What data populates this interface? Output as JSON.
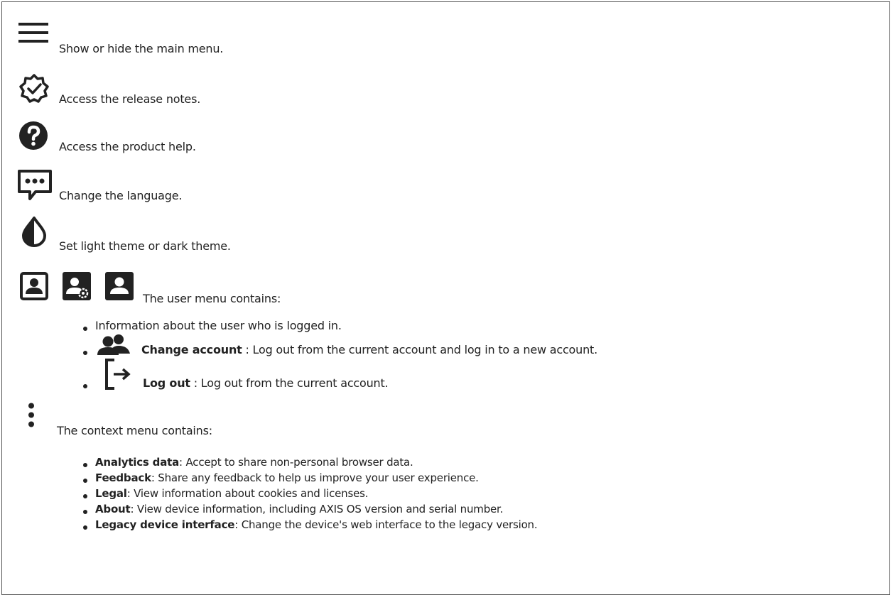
{
  "items": {
    "menu": "Show or hide the main menu.",
    "release": "Access the release notes.",
    "help": "Access the product help.",
    "language": "Change the language.",
    "theme": "Set light theme or dark theme.",
    "user": "The user menu contains:"
  },
  "user_menu": {
    "info": "Information about the user who is logged in.",
    "change_account_label": "Change account",
    "change_account_text": " : Log out from the current account and log in to a new account.",
    "logout_label": "Log out",
    "logout_text": " : Log out from the current account."
  },
  "context": {
    "intro": "The context menu contains:",
    "items": [
      {
        "label": "Analytics data",
        "text": ": Accept to share non-personal browser data."
      },
      {
        "label": "Feedback",
        "text": ": Share any feedback to help us improve your user experience."
      },
      {
        "label": "Legal",
        "text": ": View information about cookies and licenses."
      },
      {
        "label": "About",
        "text": ": View device information, including AXIS OS version and serial number."
      },
      {
        "label": "Legacy device interface",
        "text": ": Change the device's web interface to the legacy version."
      }
    ]
  },
  "icons": [
    "menu-icon",
    "release-notes-icon",
    "help-icon",
    "language-icon",
    "theme-icon",
    "user-icon",
    "user-settings-icon",
    "user-filled-icon",
    "change-account-icon",
    "log-out-icon",
    "context-menu-icon"
  ]
}
